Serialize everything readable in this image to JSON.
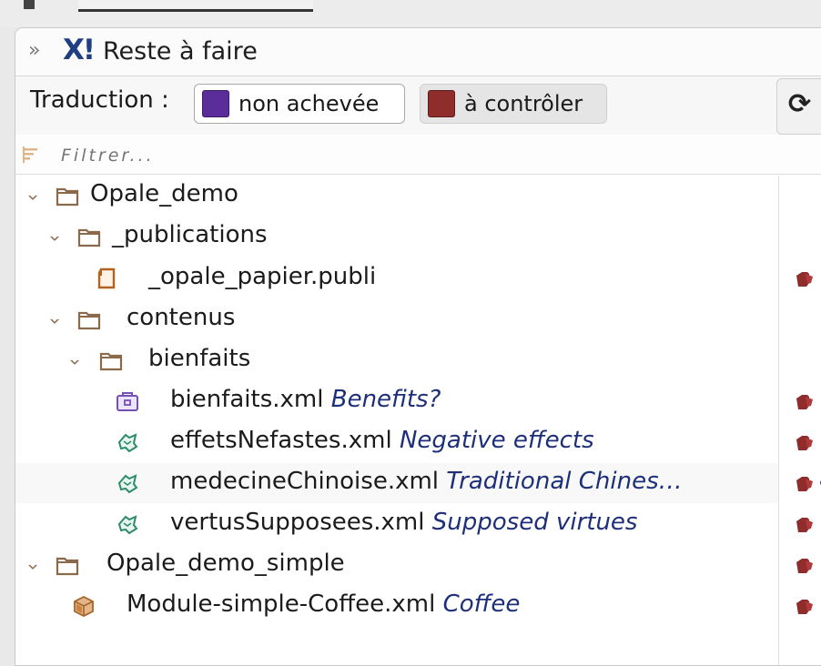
{
  "panel": {
    "title": "Reste à faire",
    "collapse_glyph": "»",
    "logo_glyph": "X!"
  },
  "toolbar": {
    "label": "Traduction :",
    "filters": [
      {
        "label": "non achevée",
        "color": "#5b2d9a",
        "active": true
      },
      {
        "label": "à contrôler",
        "color": "#8f2c2c",
        "active": false
      }
    ],
    "refresh_icon": "refresh-icon"
  },
  "filter": {
    "placeholder": "Filtrer..."
  },
  "tree": {
    "items": [
      {
        "name": "Opale_demo",
        "title": "",
        "kind": "folder",
        "expanded": true
      },
      {
        "name": "_publications",
        "title": "",
        "kind": "folder",
        "expanded": true
      },
      {
        "name": "_opale_papier.publi",
        "title": "",
        "kind": "publication",
        "status": "à contrôler"
      },
      {
        "name": "contenus",
        "title": "",
        "kind": "folder",
        "expanded": true
      },
      {
        "name": "bienfaits",
        "title": "",
        "kind": "folder",
        "expanded": true
      },
      {
        "name": "bienfaits.xml",
        "title": "Benefits?",
        "kind": "module",
        "status": "à contrôler"
      },
      {
        "name": "effetsNefastes.xml",
        "title": "Negative effects",
        "kind": "grain",
        "status": "à contrôler"
      },
      {
        "name": "medecineChinoise.xml",
        "title": "Traditional Chines…",
        "kind": "grain",
        "status": "à contrôler",
        "selected": true
      },
      {
        "name": "vertusSupposees.xml",
        "title": "Supposed virtues",
        "kind": "grain",
        "status": "à contrôler"
      },
      {
        "name": "Opale_demo_simple",
        "title": "",
        "kind": "folder",
        "expanded": true
      },
      {
        "name": "Module-simple-Coffee.xml",
        "title": "Coffee",
        "kind": "cube",
        "status": "à contrôler"
      }
    ]
  }
}
